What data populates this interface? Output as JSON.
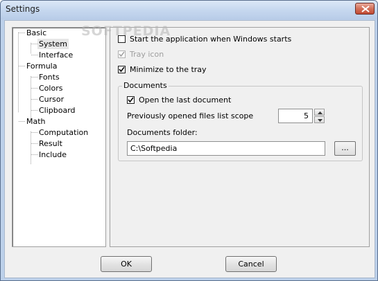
{
  "window": {
    "title": "Settings"
  },
  "watermark": "SOFTPEDIA",
  "tree": {
    "items": [
      {
        "label": "Basic"
      },
      {
        "label": "System"
      },
      {
        "label": "Interface"
      },
      {
        "label": "Formula"
      },
      {
        "label": "Fonts"
      },
      {
        "label": "Colors"
      },
      {
        "label": "Cursor"
      },
      {
        "label": "Clipboard"
      },
      {
        "label": "Math"
      },
      {
        "label": "Computation"
      },
      {
        "label": "Result"
      },
      {
        "label": "Include"
      }
    ],
    "selected": "System"
  },
  "system": {
    "start_with_windows": {
      "label": "Start the application when Windows starts",
      "checked": false
    },
    "tray_icon": {
      "label": "Tray icon",
      "checked": true,
      "enabled": false
    },
    "minimize_to_tray": {
      "label": "Minimize to the tray",
      "checked": true
    },
    "documents": {
      "legend": "Documents",
      "open_last": {
        "label": "Open the last document",
        "checked": true
      },
      "scope_label": "Previously opened files list scope",
      "scope_value": "5",
      "folder_label": "Documents folder:",
      "folder_value": "C:\\Softpedia",
      "browse_label": "..."
    }
  },
  "buttons": {
    "ok": "OK",
    "cancel": "Cancel"
  }
}
